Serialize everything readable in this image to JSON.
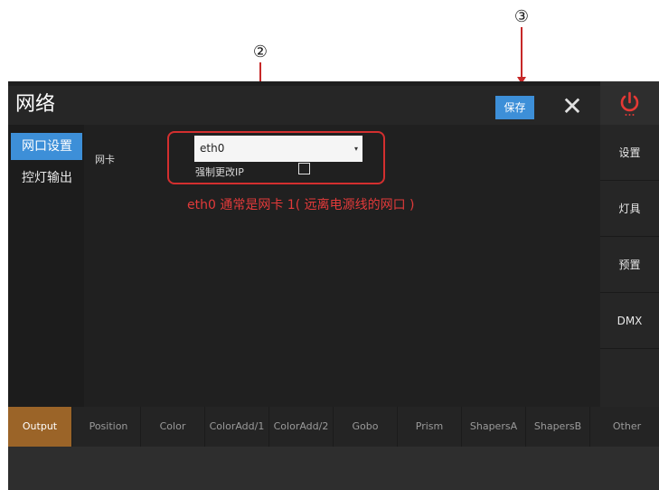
{
  "annotations": {
    "marker2": "②",
    "marker3": "③",
    "note": "eth0 通常是网卡 1( 远离电源线的网口 )"
  },
  "window": {
    "title": "网络",
    "save_label": "保存",
    "close_icon": "✕"
  },
  "colors": {
    "accent": "#3d8fd8",
    "active_tab": "#9b6428",
    "power": "#e53935",
    "annotation": "#d32f2f"
  },
  "left_menu": {
    "items": [
      {
        "label": "网口设置",
        "active": true
      },
      {
        "label": "控灯输出",
        "active": false
      }
    ]
  },
  "form": {
    "nic_label": "网卡",
    "nic_value": "eth0",
    "force_ip_label": "强制更改IP",
    "force_ip_checked": false
  },
  "right_menu": {
    "items": [
      {
        "label": "设置"
      },
      {
        "label": "灯具"
      },
      {
        "label": "预置"
      },
      {
        "label": "DMX"
      }
    ]
  },
  "tabs": [
    {
      "label": "Output",
      "active": true
    },
    {
      "label": "Position"
    },
    {
      "label": "Color"
    },
    {
      "label": "ColorAdd/1"
    },
    {
      "label": "ColorAdd/2"
    },
    {
      "label": "Gobo"
    },
    {
      "label": "Prism"
    },
    {
      "label": "ShapersA"
    },
    {
      "label": "ShapersB"
    },
    {
      "label": "Other"
    }
  ]
}
